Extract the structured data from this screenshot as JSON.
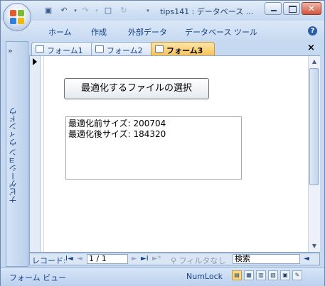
{
  "window": {
    "title": "tips141 : データベース ..."
  },
  "qat": {
    "icons": [
      "save-icon",
      "undo-icon",
      "redo-icon",
      "new-icon",
      "refresh-icon",
      "customize-icon"
    ]
  },
  "ribbon": {
    "tabs": [
      "ホーム",
      "作成",
      "外部データ",
      "データベース ツール"
    ]
  },
  "nav": {
    "toggle": "»",
    "label": "ナビゲーション ウィンドウ"
  },
  "doctabs": [
    {
      "label": "フォーム1",
      "active": false
    },
    {
      "label": "フォーム2",
      "active": false
    },
    {
      "label": "フォーム3",
      "active": true
    }
  ],
  "doc_close": "×",
  "form": {
    "select_button": "最適化するファイルの選択",
    "result_lines": "最適化前サイズ: 200704\n最適化後サイズ: 184320"
  },
  "record_nav": {
    "label": "レコード:",
    "first": "I◄",
    "prev": "◄",
    "current": "1 / 1",
    "next": "►",
    "last": "►I",
    "new": "►*",
    "filter": "フィルタなし",
    "search": "検索"
  },
  "status": {
    "mode": "フォーム ビュー",
    "numlock": "NumLock"
  },
  "colors": {
    "accent": "#15428b",
    "active_tab": "#f7c35a",
    "frame": "#c5d9f1"
  }
}
